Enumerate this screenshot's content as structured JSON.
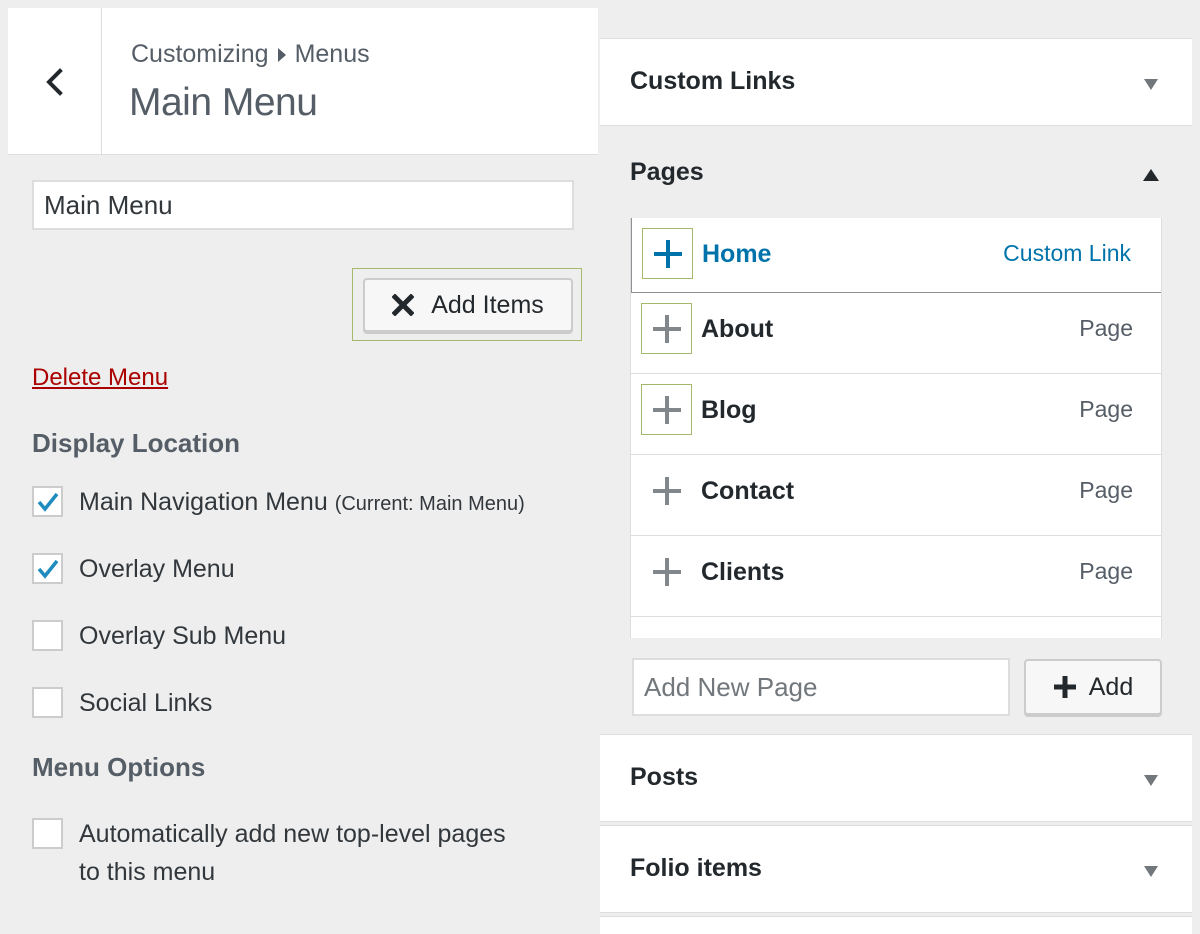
{
  "left_panel": {
    "breadcrumb": {
      "parent": "Customizing",
      "child": "Menus"
    },
    "title": "Main Menu",
    "menu_name_value": "Main Menu",
    "add_items_label": "Add Items",
    "delete_menu_label": "Delete Menu",
    "display_location": {
      "heading": "Display Location",
      "items": [
        {
          "label": "Main Navigation Menu",
          "sub": "(Current: Main Menu)",
          "checked": true
        },
        {
          "label": "Overlay Menu",
          "sub": "",
          "checked": true
        },
        {
          "label": "Overlay Sub Menu",
          "sub": "",
          "checked": false
        },
        {
          "label": "Social Links",
          "sub": "",
          "checked": false
        }
      ]
    },
    "menu_options": {
      "heading": "Menu Options",
      "auto_add_line1": "Automatically add new top-level pages",
      "auto_add_line2": "to this menu",
      "auto_add_checked": false
    }
  },
  "right_panel": {
    "custom_links": {
      "title": "Custom Links"
    },
    "pages": {
      "title": "Pages",
      "items": [
        {
          "title": "Home",
          "type": "Custom Link"
        },
        {
          "title": "About",
          "type": "Page"
        },
        {
          "title": "Blog",
          "type": "Page"
        },
        {
          "title": "Contact",
          "type": "Page"
        },
        {
          "title": "Clients",
          "type": "Page"
        }
      ],
      "new_page_placeholder": "Add New Page",
      "add_label": "Add"
    },
    "posts": {
      "title": "Posts"
    },
    "folio_items": {
      "title": "Folio items"
    }
  },
  "colors": {
    "accent": "#0073aa",
    "delete": "#aa0000",
    "focus_outline": "#a4b96b"
  },
  "icons": {
    "back": "chevron-left-icon",
    "add_items": "close-x-icon",
    "item_add": "plus-icon",
    "accordion_closed": "triangle-down-icon",
    "accordion_open": "triangle-up-icon",
    "checkbox_checked": "checkmark-icon"
  }
}
